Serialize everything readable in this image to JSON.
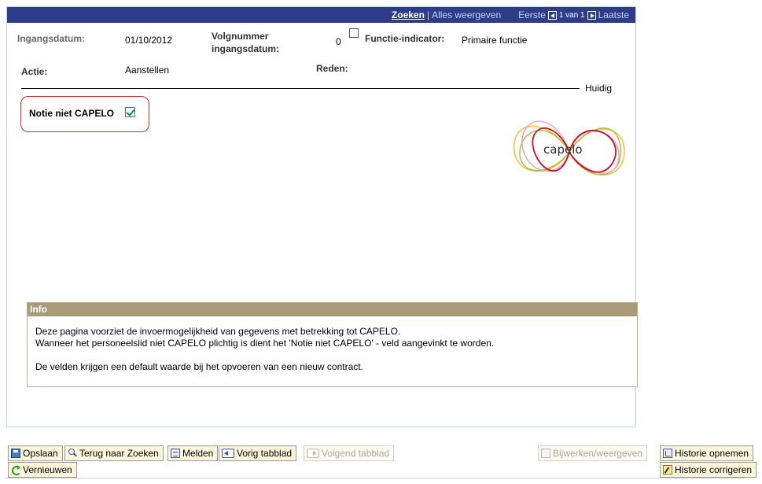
{
  "topbar": {
    "search": "Zoeken",
    "separator": "|",
    "show_all": "Alles weergeven",
    "first": "Eerste",
    "counter": "1 van 1",
    "last": "Laatste"
  },
  "header": {
    "ingangsdatum_label": "Ingangsdatum:",
    "ingangsdatum_value": "01/10/2012",
    "volgnummer_label_line1": "Volgnummer",
    "volgnummer_label_line2": "ingangsdatum:",
    "volgnummer_value": "0",
    "functie_label": "Functie-indicator:",
    "functie_value": "Primaire functie",
    "actie_label": "Actie:",
    "actie_value": "Aanstellen",
    "reden_label": "Reden:",
    "status": "Huidig"
  },
  "notie": {
    "label": "Notie niet CAPELO",
    "checked": true
  },
  "logo": {
    "text": "capelo",
    "colors": [
      "#c8102e",
      "#f2c14e",
      "#9fbf3b",
      "#e8a3b2"
    ]
  },
  "info": {
    "title": "Info",
    "line1": "Deze pagina voorziet de invoermogelijkheid van gegevens met betrekking tot CAPELO.",
    "line2": "Wanneer het personeelslid niet CAPELO plichtig is dient het 'Notie niet CAPELO' - veld aangevinkt te worden.",
    "line3": "De velden krijgen een default waarde bij het opvoeren van een nieuw contract."
  },
  "toolbar": {
    "save": "Opslaan",
    "back_to_search": "Terug naar Zoeken",
    "notify": "Melden",
    "prev_tab": "Vorig tabblad",
    "next_tab": "Volgend tabblad",
    "update_view": "Bijwerken/weergeven",
    "include_history": "Historie opnemen",
    "refresh": "Vernieuwen",
    "correct_history": "Historie corrigeren"
  }
}
